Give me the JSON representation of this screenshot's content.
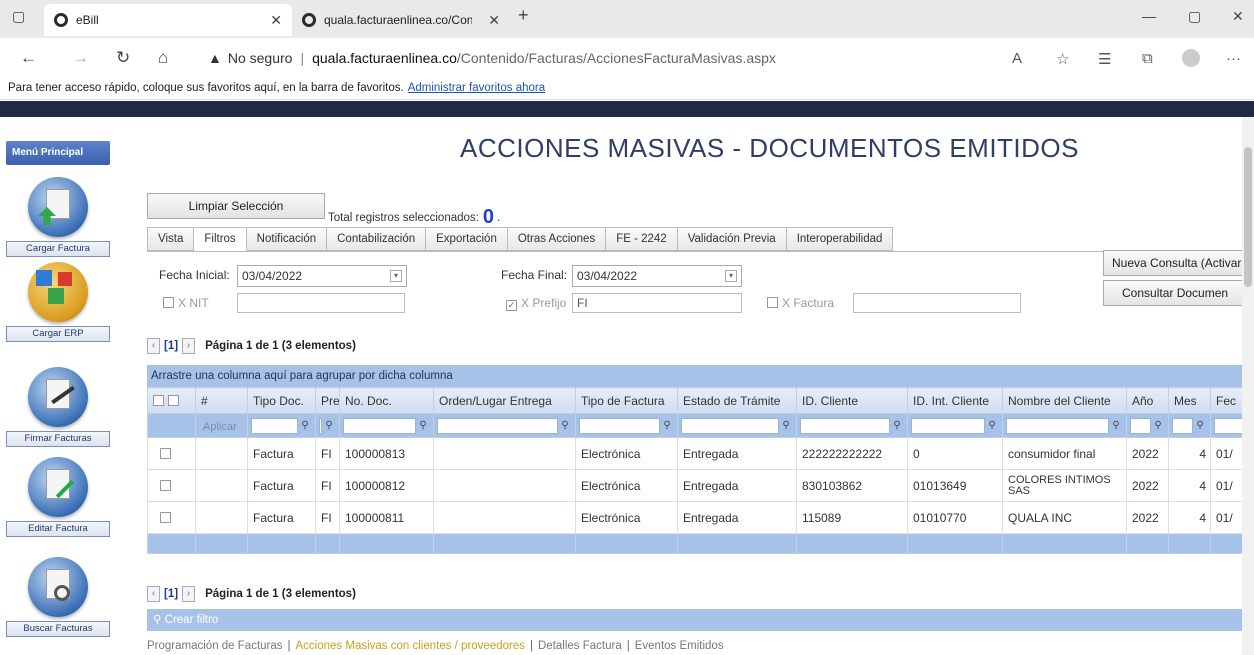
{
  "browser": {
    "tabs": [
      {
        "title": "eBill",
        "active": true
      },
      {
        "title": "quala.facturaenlinea.co/Contenic",
        "active": false
      }
    ],
    "security_label": "No seguro",
    "url_host": "quala.facturaenlinea.co",
    "url_path": "/Contenido/Facturas/AccionesFacturaMasivas.aspx",
    "favorites_text": "Para tener acceso rápido, coloque sus favoritos aquí, en la barra de favoritos.",
    "favorites_link": "Administrar favoritos ahora"
  },
  "sidebar": {
    "header": "Menú Principal",
    "items": [
      {
        "label": "Cargar Factura",
        "icon": "upload-invoice-icon"
      },
      {
        "label": "Cargar ERP",
        "icon": "erp-boxes-icon"
      },
      {
        "label": "Firmar Facturas",
        "icon": "sign-document-icon"
      },
      {
        "label": "Editar Factura",
        "icon": "edit-document-icon"
      },
      {
        "label": "Buscar Facturas",
        "icon": "search-document-icon"
      }
    ]
  },
  "page": {
    "title": "ACCIONES MASIVAS - DOCUMENTOS EMITIDOS",
    "clear_button": "Limpiar Selección",
    "total_label": "Total registros seleccionados:",
    "total_count": "0",
    "tabs": [
      "Vista",
      "Filtros",
      "Notificación",
      "Contabilización",
      "Exportación",
      "Otras Acciones",
      "FE - 2242",
      "Validación Previa",
      "Interoperabilidad"
    ],
    "active_tab": "Filtros"
  },
  "filters": {
    "fecha_inicial_label": "Fecha Inicial:",
    "fecha_inicial_value": "03/04/2022",
    "fecha_final_label": "Fecha Final:",
    "fecha_final_value": "03/04/2022",
    "nit_label": "X NIT",
    "nit_value": "",
    "prefijo_label": "X Prefijo",
    "prefijo_checked": true,
    "prefijo_value": "FI",
    "factura_label": "X Factura",
    "factura_value": "",
    "nueva_consulta": "Nueva Consulta (Activar",
    "consultar": "Consultar Documen"
  },
  "pager": {
    "current": "[1]",
    "info": "Página 1 de 1 (3 elementos)"
  },
  "grid": {
    "group_hint": "Arrastre una columna aquí para agrupar por dicha columna",
    "apply_label": "Aplicar",
    "columns": [
      "#",
      "Tipo Doc.",
      "Pre",
      "No. Doc.",
      "Orden/Lugar Entrega",
      "Tipo de Factura",
      "Estado de Trámite",
      "ID. Cliente",
      "ID. Int. Cliente",
      "Nombre del Cliente",
      "Año",
      "Mes",
      "Fec"
    ],
    "rows": [
      {
        "tipo": "Factura",
        "pre": "FI",
        "no": "100000813",
        "orden": "",
        "tipofac": "Electrónica",
        "estado": "Entregada",
        "idcli": "222222222222",
        "idint": "0",
        "nombre": "consumidor final",
        "anio": "2022",
        "mes": "4",
        "fec": "01/"
      },
      {
        "tipo": "Factura",
        "pre": "FI",
        "no": "100000812",
        "orden": "",
        "tipofac": "Electrónica",
        "estado": "Entregada",
        "idcli": "830103862",
        "idint": "01013649",
        "nombre": "COLORES INTIMOS SAS",
        "anio": "2022",
        "mes": "4",
        "fec": "01/"
      },
      {
        "tipo": "Factura",
        "pre": "FI",
        "no": "100000811",
        "orden": "",
        "tipofac": "Electrónica",
        "estado": "Entregada",
        "idcli": "115089",
        "idint": "01010770",
        "nombre": "QUALA INC",
        "anio": "2022",
        "mes": "4",
        "fec": "01/"
      }
    ],
    "create_filter": "Crear filtro"
  },
  "footer_links": [
    "Programación de Facturas",
    "Acciones Masivas con clientes / proveedores",
    "Detalles Factura",
    "Eventos Emitidos"
  ]
}
